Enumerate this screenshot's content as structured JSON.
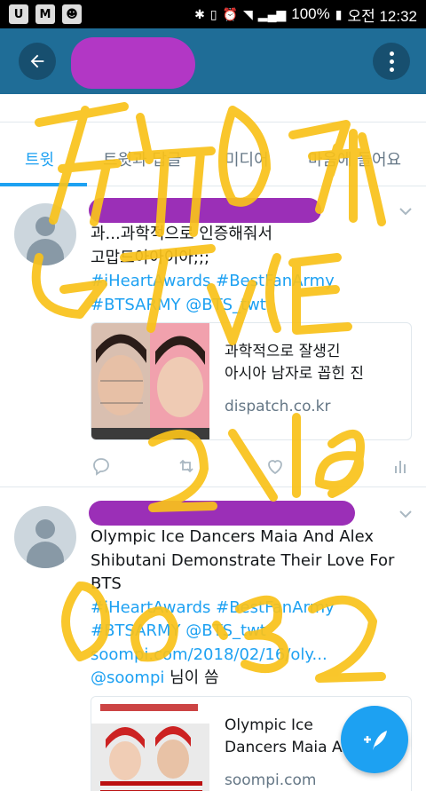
{
  "status_bar": {
    "battery_percent": "100%",
    "time": "오전 12:32"
  },
  "app_bar": {
    "back_icon": "arrow-left-icon",
    "more_icon": "more-vertical-icon"
  },
  "tabs": [
    {
      "label": "트윗",
      "active": true
    },
    {
      "label": "트윗과 답글",
      "active": false
    },
    {
      "label": "미디어",
      "active": false
    },
    {
      "label": "마음에 들어요",
      "active": false
    }
  ],
  "tweets": [
    {
      "text_line1": "과...과학적으로 인증해줘서",
      "text_line2": "고맙드아아이아;;;",
      "hashtags_line1": "#iHeartAwards #BestFanArmy",
      "hashtags_line2": "#BTSARMY @BTS_twt",
      "card_title_line1": "과학적으로 잘생긴",
      "card_title_line2": "아시아 남자로 꼽힌 진",
      "card_domain": "dispatch.co.kr"
    },
    {
      "text_line1": "Olympic Ice Dancers Maia And Alex",
      "text_line2": "Shibutani Demonstrate Their Love For",
      "text_line3": "BTS",
      "hashtags_line1": "#iHeartAwards #BestFanArmy",
      "hashtags_line2": "#BTSARMY @BTS_twt",
      "link": "soompi.com/2018/02/16/oly...",
      "mention": "@soompi",
      "via": "님이 씀",
      "card_title_line1": "Olympic Ice",
      "card_title_line2": "Dancers Maia A...",
      "card_domain": "soompi.com"
    }
  ],
  "fab_icon": "compose-tweet-icon",
  "colors": {
    "app_bar": "#1f6d97",
    "accent": "#1da1f2",
    "handwriting": "#f9c21a",
    "redaction": "#a531c0"
  }
}
